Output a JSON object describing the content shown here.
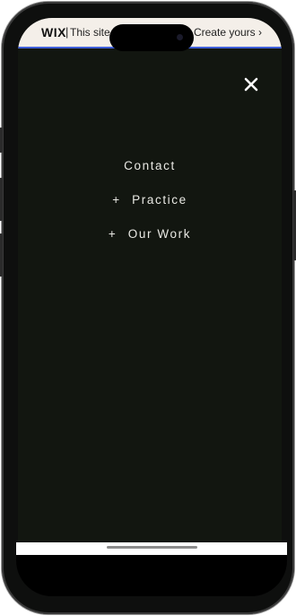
{
  "wix_bar": {
    "logo": "WIX",
    "separator": "|",
    "message": "This site",
    "cta": "Create yours ›"
  },
  "close_icon": "close-icon",
  "menu": {
    "items": [
      {
        "prefix": "",
        "label": "Contact"
      },
      {
        "prefix": "+",
        "label": "Practice"
      },
      {
        "prefix": "+",
        "label": "Our Work"
      }
    ]
  },
  "colors": {
    "overlay_background": "#121610",
    "menu_text": "#e9e9e4",
    "banner_background": "#f4efe9",
    "banner_accent": "#3f5fd9"
  }
}
